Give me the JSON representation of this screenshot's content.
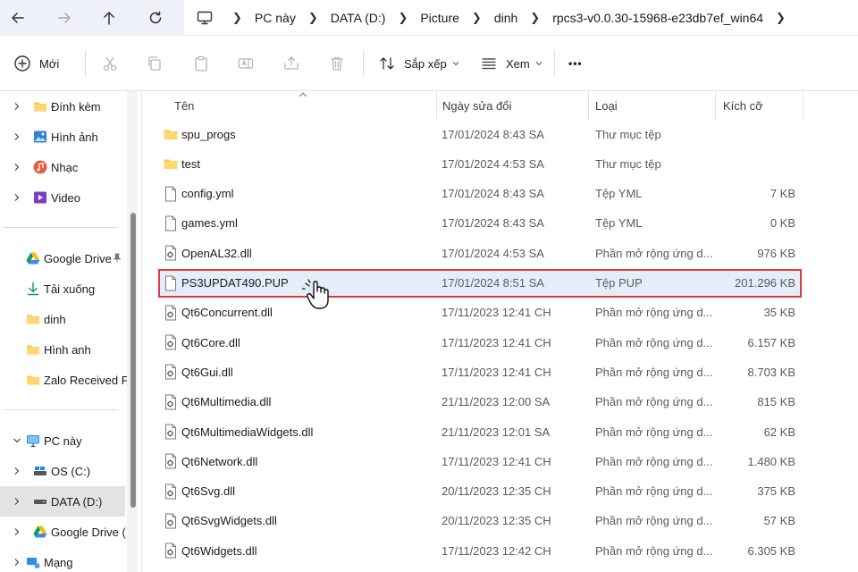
{
  "breadcrumb": [
    "PC này",
    "DATA (D:)",
    "Picture",
    "dinh",
    "rpcs3-v0.0.30-15968-e23db7ef_win64"
  ],
  "toolbar": {
    "new_label": "Mới",
    "sort_label": "Sắp xếp",
    "view_label": "Xem",
    "more_label": "•••"
  },
  "sidebar": {
    "quick": [
      {
        "label": "Đính kèm",
        "icon": "folder-icon"
      },
      {
        "label": "Hình ảnh",
        "icon": "pictures-icon"
      },
      {
        "label": "Nhạc",
        "icon": "music-icon"
      },
      {
        "label": "Video",
        "icon": "video-icon"
      }
    ],
    "pinned": [
      {
        "label": "Google Drive",
        "icon": "google-drive-icon",
        "pinned": true
      },
      {
        "label": "Tải xuống",
        "icon": "download-icon"
      },
      {
        "label": "dinh",
        "icon": "folder-icon"
      },
      {
        "label": "Hình anh",
        "icon": "folder-icon"
      },
      {
        "label": "Zalo Received Fil",
        "icon": "folder-icon"
      }
    ],
    "tree": [
      {
        "label": "PC này",
        "icon": "pc-icon",
        "expanded": true
      },
      {
        "label": "OS (C:)",
        "icon": "os-drive-icon"
      },
      {
        "label": "DATA (D:)",
        "icon": "drive-icon",
        "selected": true
      },
      {
        "label": "Google Drive (",
        "icon": "google-drive-icon"
      },
      {
        "label": "Mạng",
        "icon": "network-icon"
      }
    ]
  },
  "columns": {
    "name": "Tên",
    "date": "Ngày sửa đổi",
    "type": "Loại",
    "size": "Kích cỡ"
  },
  "files": [
    {
      "name": "spu_progs",
      "date": "17/01/2024 8:43 SA",
      "type": "Thư mục tệp",
      "size": "",
      "icon": "folder"
    },
    {
      "name": "test",
      "date": "17/01/2024 4:53 SA",
      "type": "Thư mục tệp",
      "size": "",
      "icon": "folder"
    },
    {
      "name": "config.yml",
      "date": "17/01/2024 8:43 SA",
      "type": "Tệp YML",
      "size": "7 KB",
      "icon": "file"
    },
    {
      "name": "games.yml",
      "date": "17/01/2024 8:43 SA",
      "type": "Tệp YML",
      "size": "0 KB",
      "icon": "file"
    },
    {
      "name": "OpenAL32.dll",
      "date": "17/01/2024 4:53 SA",
      "type": "Phần mở rộng ứng d...",
      "size": "976 KB",
      "icon": "dll"
    },
    {
      "name": "PS3UPDAT490.PUP",
      "date": "17/01/2024 8:51 SA",
      "type": "Tệp PUP",
      "size": "201.296 KB",
      "icon": "file",
      "selected": true
    },
    {
      "name": "Qt6Concurrent.dll",
      "date": "17/11/2023 12:41 CH",
      "type": "Phần mở rộng ứng d...",
      "size": "35 KB",
      "icon": "dll"
    },
    {
      "name": "Qt6Core.dll",
      "date": "17/11/2023 12:41 CH",
      "type": "Phần mở rộng ứng d...",
      "size": "6.157 KB",
      "icon": "dll"
    },
    {
      "name": "Qt6Gui.dll",
      "date": "17/11/2023 12:41 CH",
      "type": "Phần mở rộng ứng d...",
      "size": "8.703 KB",
      "icon": "dll"
    },
    {
      "name": "Qt6Multimedia.dll",
      "date": "21/11/2023 12:00 SA",
      "type": "Phần mở rộng ứng d...",
      "size": "815 KB",
      "icon": "dll"
    },
    {
      "name": "Qt6MultimediaWidgets.dll",
      "date": "21/11/2023 12:01 SA",
      "type": "Phần mở rộng ứng d...",
      "size": "62 KB",
      "icon": "dll"
    },
    {
      "name": "Qt6Network.dll",
      "date": "17/11/2023 12:41 CH",
      "type": "Phần mở rộng ứng d...",
      "size": "1.480 KB",
      "icon": "dll"
    },
    {
      "name": "Qt6Svg.dll",
      "date": "20/11/2023 12:35 CH",
      "type": "Phần mở rộng ứng d...",
      "size": "375 KB",
      "icon": "dll"
    },
    {
      "name": "Qt6SvgWidgets.dll",
      "date": "20/11/2023 12:35 CH",
      "type": "Phần mở rộng ứng d...",
      "size": "57 KB",
      "icon": "dll"
    },
    {
      "name": "Qt6Widgets.dll",
      "date": "17/11/2023 12:42 CH",
      "type": "Phần mở rộng ứng d...",
      "size": "6.305 KB",
      "icon": "dll"
    }
  ],
  "colors": {
    "selection_bg": "#e4eefb",
    "highlight_border": "#e0393e",
    "folder": "#f5c451",
    "accent": "#2f6fd0"
  }
}
